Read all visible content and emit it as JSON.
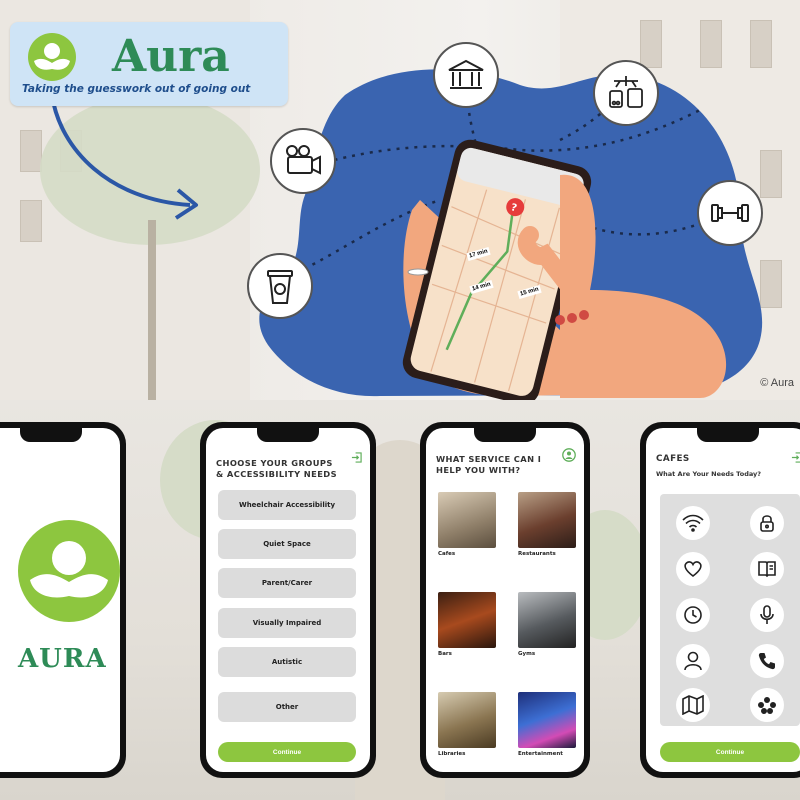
{
  "hero": {
    "brand": "Aura",
    "tagline": "Taking the guesswork out of going out",
    "copyright": "© Aura",
    "map_times": [
      "17 min",
      "14 min",
      "15 min"
    ],
    "bubble_icons": [
      "museum-icon",
      "transport-icon",
      "cinema-icon",
      "gym-icon",
      "coffee-icon"
    ]
  },
  "screens": {
    "splash": {
      "brand": "AURA"
    },
    "groups": {
      "title_line1": "CHOOSE YOUR GROUPS",
      "title_line2": "& ACCESSIBILITY NEEDS",
      "options": [
        "Wheelchair Accessibility",
        "Quiet Space",
        "Parent/Carer",
        "Visually Impaired",
        "Autistic",
        "Other"
      ],
      "continue": "Continue"
    },
    "services": {
      "title_line1": "WHAT SERVICE CAN I",
      "title_line2": "HELP YOU WITH?",
      "items": [
        "Cafes",
        "Restaurants",
        "Bars",
        "Gyms",
        "Libraries",
        "Entertainment"
      ]
    },
    "cafes": {
      "title": "CAFES",
      "subtitle": "What Are Your Needs Today?",
      "needs": [
        "wifi-icon",
        "lock-icon",
        "heart-icon",
        "book-icon",
        "clock-icon",
        "microphone-icon",
        "person-icon",
        "phone-icon",
        "map-icon",
        "group-icon"
      ],
      "continue": "Continue"
    }
  },
  "colors": {
    "brand_green": "#8dc63f",
    "brand_text": "#2e8b57",
    "blob_blue": "#3a64b0",
    "tag_blue": "#1f4e8c"
  }
}
